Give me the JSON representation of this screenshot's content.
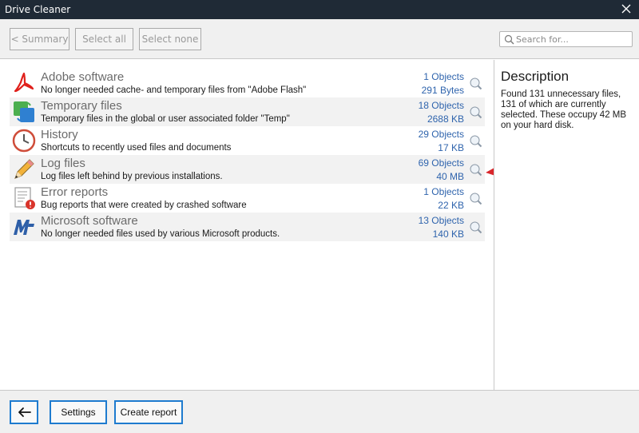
{
  "window": {
    "title": "Drive Cleaner",
    "close_icon": "close-icon"
  },
  "toolbar": {
    "summary_label": "< Summary",
    "select_all_label": "Select all",
    "select_none_label": "Select none",
    "search_placeholder": "Search for..."
  },
  "items": [
    {
      "title": "Adobe software",
      "desc": "No longer needed cache- and temporary files from \"Adobe Flash\"",
      "objects": "1 Objects",
      "size": "291 Bytes",
      "icon": "adobe-icon"
    },
    {
      "title": "Temporary files",
      "desc": "Temporary files in the global or user associated folder \"Temp\"",
      "objects": "18 Objects",
      "size": "2688 KB",
      "icon": "temp-files-icon"
    },
    {
      "title": "History",
      "desc": "Shortcuts to recently used files and documents",
      "objects": "29 Objects",
      "size": "17 KB",
      "icon": "clock-icon"
    },
    {
      "title": "Log files",
      "desc": "Log files left behind by previous installations.",
      "objects": "69 Objects",
      "size": "40 MB",
      "icon": "pencil-icon"
    },
    {
      "title": "Error reports",
      "desc": "Bug reports that were created by crashed software",
      "objects": "1 Objects",
      "size": "22 KB",
      "icon": "error-report-icon"
    },
    {
      "title": "Microsoft software",
      "desc": "No longer needed files used by various Microsoft products.",
      "objects": "13 Objects",
      "size": "140 KB",
      "icon": "microsoft-icon"
    }
  ],
  "description": {
    "heading": "Description",
    "text": "Found 131 unnecessary files, 131 of which are currently selected. These occupy 42 MB on your hard disk."
  },
  "footer": {
    "back_icon": "back-arrow-icon",
    "settings_label": "Settings",
    "create_report_label": "Create report"
  },
  "colors": {
    "titlebar": "#1f2a36",
    "link_blue": "#2f64ad",
    "accent_border": "#1e7bcf",
    "annotation_arrow": "#d9262b"
  }
}
